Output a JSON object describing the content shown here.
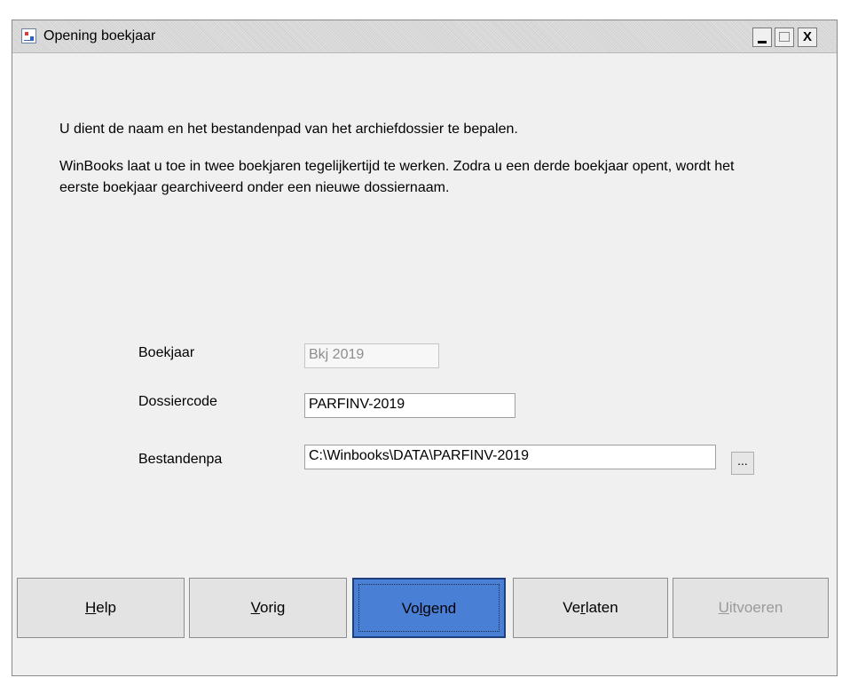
{
  "window": {
    "title": "Opening boekjaar",
    "controls": {
      "minimize": "_",
      "maximize": "",
      "close": "X"
    }
  },
  "intro": {
    "line1": "U dient de naam en het bestandenpad van het archiefdossier te bepalen.",
    "line2": "WinBooks laat u toe in twee boekjaren tegelijkertijd te werken. Zodra u een derde boekjaar opent, wordt het eerste boekjaar gearchiveerd onder een nieuwe dossiernaam."
  },
  "form": {
    "boekjaar": {
      "label": "Boekjaar",
      "value": "Bkj 2019"
    },
    "dossiercode": {
      "label": "Dossiercode",
      "value": "PARFINV-2019"
    },
    "bestandenpad": {
      "label": "Bestandenpa",
      "value": "C:\\Winbooks\\DATA\\PARFINV-2019"
    },
    "browse_label": "..."
  },
  "buttons": {
    "help": {
      "pre": "",
      "key": "H",
      "post": "elp"
    },
    "vorig": {
      "pre": "",
      "key": "V",
      "post": "orig"
    },
    "volgend": {
      "pre": "Vo",
      "key": "l",
      "post": "gend"
    },
    "verlaten": {
      "pre": "Ve",
      "key": "r",
      "post": "laten"
    },
    "uitvoeren": {
      "pre": "",
      "key": "U",
      "post": "itvoeren"
    }
  }
}
